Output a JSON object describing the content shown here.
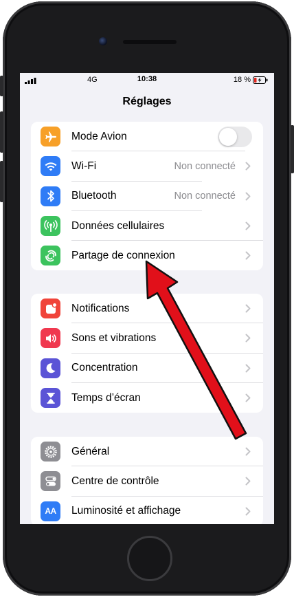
{
  "status_bar": {
    "network": "4G",
    "time": "10:38",
    "battery_percent": "18 %"
  },
  "nav": {
    "title": "Réglages"
  },
  "groups": [
    {
      "rows": [
        {
          "label": "Mode Avion",
          "icon": "airplane-icon",
          "color": "#f7a028",
          "control": "toggle",
          "toggle_on": false
        },
        {
          "label": "Wi-Fi",
          "icon": "wifi-icon",
          "color": "#2f7cf6",
          "value": "Non connecté"
        },
        {
          "label": "Bluetooth",
          "icon": "bluetooth-icon",
          "color": "#2f7cf6",
          "value": "Non connecté"
        },
        {
          "label": "Données cellulaires",
          "icon": "cellular-icon",
          "color": "#3cc35e"
        },
        {
          "label": "Partage de connexion",
          "icon": "hotspot-icon",
          "color": "#3cc35e"
        }
      ]
    },
    {
      "rows": [
        {
          "label": "Notifications",
          "icon": "notifications-icon",
          "color": "#f0443a"
        },
        {
          "label": "Sons et vibrations",
          "icon": "sound-icon",
          "color": "#f0384f"
        },
        {
          "label": "Concentration",
          "icon": "moon-icon",
          "color": "#5b54d6"
        },
        {
          "label": "Temps d’écran",
          "icon": "hourglass-icon",
          "color": "#5b54d6"
        }
      ]
    },
    {
      "rows": [
        {
          "label": "Général",
          "icon": "gear-icon",
          "color": "#8e8e93"
        },
        {
          "label": "Centre de contrôle",
          "icon": "control-center-icon",
          "color": "#8e8e93"
        },
        {
          "label": "Luminosité et affichage",
          "icon": "display-brightness-icon",
          "color": "#2f7cf6",
          "glyph": "AA"
        }
      ]
    }
  ],
  "annotation": {
    "arrow_color": "#e1101a",
    "points_to": "Partage de connexion"
  }
}
